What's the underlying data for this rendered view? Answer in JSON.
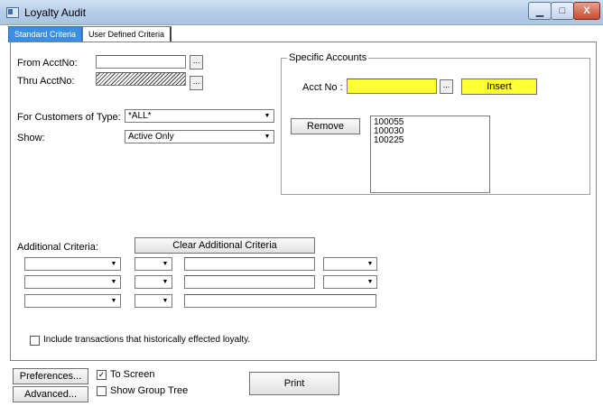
{
  "window": {
    "title": "Loyalty Audit",
    "minimize": "▁",
    "maximize": "□",
    "close": "X"
  },
  "tabs": {
    "standard": "Standard Criteria",
    "user_defined": "User Defined Criteria"
  },
  "criteria": {
    "from_acct_label": "From AcctNo:",
    "thru_acct_label": "Thru AcctNo:",
    "browse": "...",
    "customer_type_label": "For Customers of Type:",
    "customer_type_value": "*ALL*",
    "show_label": "Show:",
    "show_value": "Active Only"
  },
  "specific_accounts": {
    "legend": "Specific Accounts",
    "acct_label": "Acct No :",
    "insert": "Insert",
    "remove": "Remove",
    "accounts": [
      "100055",
      "100030",
      "100225"
    ]
  },
  "additional": {
    "label": "Additional Criteria:",
    "clear": "Clear Additional Criteria",
    "dropdown_arrow": "▼"
  },
  "include_transactions": "Include transactions that historically effected loyalty.",
  "footer": {
    "preferences": "Preferences...",
    "advanced": "Advanced...",
    "to_screen": "To Screen",
    "to_screen_checked": "✓",
    "show_group_tree": "Show Group Tree",
    "print": "Print"
  },
  "colors": {
    "highlight": "#ffff33",
    "tab_active": "#3a8ee6"
  }
}
